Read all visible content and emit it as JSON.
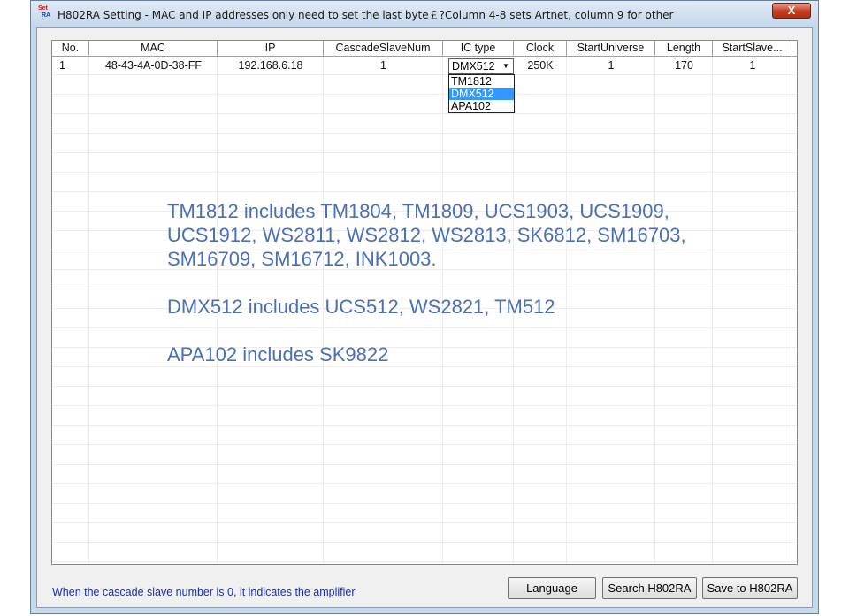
{
  "window": {
    "title": "H802RA Setting - MAC and IP addresses only need to set the last byte￡?Column 4-8 sets Artnet, column 9 for other",
    "icon_text_top": "Set",
    "icon_text_bottom": "RA",
    "close_label": "X"
  },
  "grid": {
    "headers": [
      "No.",
      "MAC",
      "IP",
      "CascadeSlaveNum",
      "IC type",
      "Clock",
      "StartUniverse",
      "Length",
      "StartSlave..."
    ],
    "rows": [
      {
        "no": "1",
        "mac": "48-43-4A-0D-38-FF",
        "ip": "192.168.6.18",
        "cascade": "1",
        "ic_type": "DMX512",
        "clock": "250K",
        "start_universe": "1",
        "length": "170",
        "start_slave": "1"
      }
    ]
  },
  "ic_dropdown": {
    "selected": "DMX512",
    "arrow_icon": "dropdown-arrow-icon",
    "options": [
      "TM1812",
      "DMX512",
      "APA102"
    ],
    "highlighted_index": 1,
    "highlight_color": "#3399ff"
  },
  "notes": {
    "color": "#4a6fb5",
    "tm1812_lines": [
      "TM1812 includes TM1804, TM1809, UCS1903, UCS1909,",
      "UCS1912, WS2811, WS2812, WS2813, SK6812, SM16703,",
      "SM16709, SM16712, INK1003."
    ],
    "dmx512": "DMX512 includes UCS512, WS2821, TM512",
    "apa102": "APA102 includes SK9822"
  },
  "footer": {
    "status_text": "When the cascade slave number is 0, it indicates the amplifier",
    "language_button": "Language",
    "search_button": "Search H802RA",
    "save_button": "Save to H802RA"
  }
}
